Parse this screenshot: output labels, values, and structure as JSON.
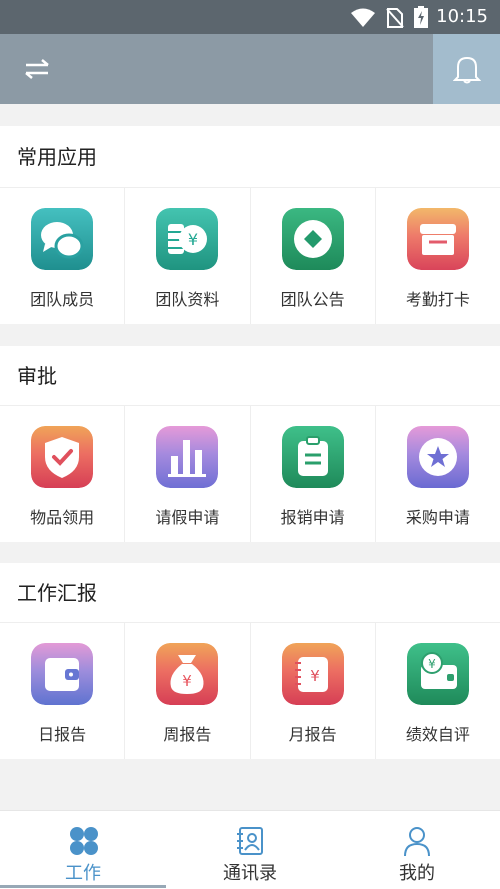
{
  "statusbar": {
    "time": "10:15"
  },
  "sections": [
    {
      "title": "常用应用",
      "items": [
        {
          "label": "团队成员",
          "icon": "chat-bubbles-icon",
          "color": "#2aa1a1"
        },
        {
          "label": "团队资料",
          "icon": "coins-yen-icon",
          "color": "#23a893"
        },
        {
          "label": "团队公告",
          "icon": "coin-diamond-icon",
          "color": "#239a6c"
        },
        {
          "label": "考勤打卡",
          "icon": "storefront-icon",
          "color": "#e35b6b"
        }
      ]
    },
    {
      "title": "审批",
      "items": [
        {
          "label": "物品领用",
          "icon": "shield-check-icon",
          "color": "#e0505d"
        },
        {
          "label": "请假申请",
          "icon": "bar-chart-icon",
          "color": "#7b6fd0"
        },
        {
          "label": "报销申请",
          "icon": "clipboard-icon",
          "color": "#2a9f6b"
        },
        {
          "label": "采购申请",
          "icon": "star-badge-icon",
          "color": "#6f6fd4"
        }
      ]
    },
    {
      "title": "工作汇报",
      "items": [
        {
          "label": "日报告",
          "icon": "wallet-icon",
          "color": "#6777d3"
        },
        {
          "label": "周报告",
          "icon": "money-bag-icon",
          "color": "#e8565f"
        },
        {
          "label": "月报告",
          "icon": "notebook-yen-icon",
          "color": "#e0505d"
        },
        {
          "label": "绩效自评",
          "icon": "cash-card-icon",
          "color": "#2e9f6e"
        }
      ]
    }
  ],
  "tabs": [
    {
      "label": "工作",
      "icon": "clover-icon",
      "active": true
    },
    {
      "label": "通讯录",
      "icon": "contacts-icon",
      "active": false
    },
    {
      "label": "我的",
      "icon": "person-icon",
      "active": false
    }
  ],
  "colors": {
    "accent": "#4a92c9",
    "appbar": "#8c9aa5",
    "statusbar": "#5c666e"
  }
}
